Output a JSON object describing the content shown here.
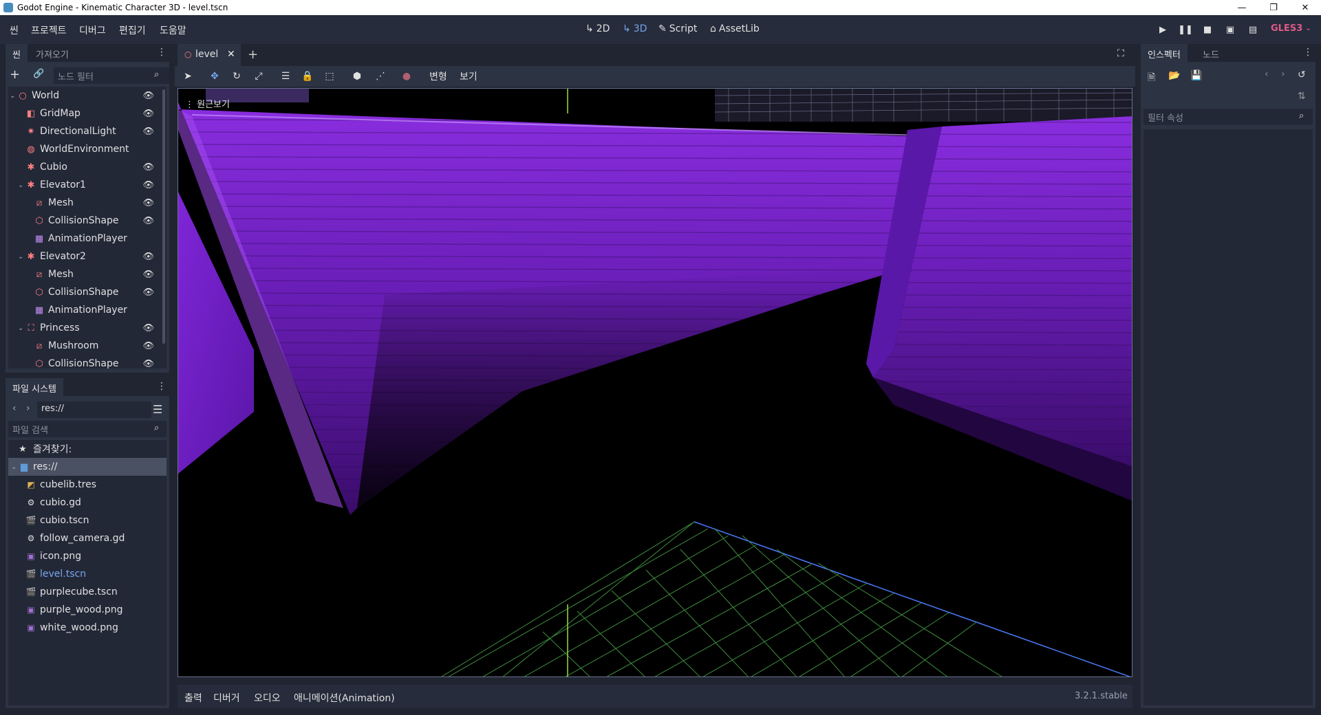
{
  "window": {
    "title": "Godot Engine - Kinematic Character 3D - level.tscn",
    "controls": [
      "—",
      "❐",
      "✕"
    ]
  },
  "menu": {
    "items": [
      "씬",
      "프로젝트",
      "디버그",
      "편집기",
      "도움말"
    ]
  },
  "modes": {
    "items": [
      {
        "label": "2D",
        "icon": "2d-icon"
      },
      {
        "label": "3D",
        "icon": "3d-icon",
        "active": true
      },
      {
        "label": "Script",
        "icon": "script-icon"
      },
      {
        "label": "AssetLib",
        "icon": "assetlib-icon"
      }
    ]
  },
  "playback": {
    "renderer": "GLES3"
  },
  "scene_dock": {
    "tabs": [
      "씬",
      "가져오기"
    ],
    "filter_placeholder": "노드 필터",
    "nodes": [
      {
        "label": "World",
        "icon": "node-spatial-icon",
        "depth": 0,
        "expanded": true,
        "color": "#fc7f7f"
      },
      {
        "label": "GridMap",
        "icon": "gridmap-icon",
        "depth": 1,
        "color": "#fc7f7f"
      },
      {
        "label": "DirectionalLight",
        "icon": "light-icon",
        "depth": 1,
        "color": "#fc7f7f"
      },
      {
        "label": "WorldEnvironment",
        "icon": "environment-icon",
        "depth": 1,
        "color": "#fc7f7f"
      },
      {
        "label": "Cubio",
        "icon": "kinematic-icon",
        "depth": 1,
        "color": "#fc7f7f"
      },
      {
        "label": "Elevator1",
        "icon": "kinematic-icon",
        "depth": 1,
        "expanded": true,
        "color": "#fc7f7f"
      },
      {
        "label": "Mesh",
        "icon": "mesh-icon",
        "depth": 2,
        "color": "#fc7f7f"
      },
      {
        "label": "CollisionShape",
        "icon": "collision-shape-icon",
        "depth": 2,
        "color": "#fc7f7f"
      },
      {
        "label": "AnimationPlayer",
        "icon": "animation-player-icon",
        "depth": 2,
        "color": "#c38ef1"
      },
      {
        "label": "Elevator2",
        "icon": "kinematic-icon",
        "depth": 1,
        "expanded": true,
        "color": "#fc7f7f"
      },
      {
        "label": "Mesh",
        "icon": "mesh-icon",
        "depth": 2,
        "color": "#fc7f7f"
      },
      {
        "label": "CollisionShape",
        "icon": "collision-shape-icon",
        "depth": 2,
        "color": "#fc7f7f"
      },
      {
        "label": "AnimationPlayer",
        "icon": "animation-player-icon",
        "depth": 2,
        "color": "#c38ef1"
      },
      {
        "label": "Princess",
        "icon": "area-icon",
        "depth": 1,
        "expanded": true,
        "color": "#fc7f7f"
      },
      {
        "label": "Mushroom",
        "icon": "mesh-icon",
        "depth": 2,
        "color": "#fc7f7f"
      },
      {
        "label": "CollisionShape",
        "icon": "collision-shape-icon",
        "depth": 2,
        "color": "#fc7f7f"
      }
    ]
  },
  "filesystem_dock": {
    "tab": "파일 시스템",
    "path": "res://",
    "search_placeholder": "파일 검색",
    "favorites_label": "즐겨찾기:",
    "root_label": "res://",
    "files": [
      {
        "label": "cubelib.tres",
        "icon": "resource-icon"
      },
      {
        "label": "cubio.gd",
        "icon": "gear-icon"
      },
      {
        "label": "cubio.tscn",
        "icon": "scene-icon"
      },
      {
        "label": "follow_camera.gd",
        "icon": "gear-icon"
      },
      {
        "label": "icon.png",
        "icon": "image-icon"
      },
      {
        "label": "level.tscn",
        "icon": "scene-icon",
        "current": true
      },
      {
        "label": "purplecube.tscn",
        "icon": "scene-icon"
      },
      {
        "label": "purple_wood.png",
        "icon": "image-icon"
      },
      {
        "label": "white_wood.png",
        "icon": "image-icon"
      }
    ]
  },
  "editor": {
    "scene_tab": "level",
    "transform_menu": "변형",
    "view_menu": "보기",
    "perspective_label": "원근보기"
  },
  "bottom_panel": {
    "items": [
      "출력",
      "디버거",
      "오디오",
      "애니메이션(Animation)"
    ],
    "version": "3.2.1.stable"
  },
  "inspector": {
    "tabs": [
      "인스펙터",
      "노드"
    ],
    "filter_placeholder": "필터 속성"
  },
  "colors": {
    "accent": "#76a6ee",
    "node_red": "#fc7f7f",
    "purple_wood": "#7a1fd0",
    "grid_green": "#4fa04f",
    "axis_blue": "#4a7cff"
  }
}
